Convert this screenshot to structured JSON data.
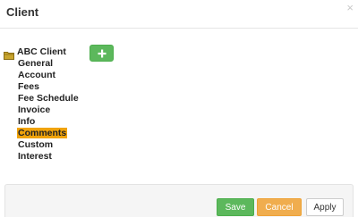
{
  "modal": {
    "title": "Client",
    "close_icon": "close-icon"
  },
  "tree": {
    "root": {
      "label": "ABC Client",
      "icon": "folder-icon"
    },
    "items": [
      {
        "label": "General"
      },
      {
        "label": "Account"
      },
      {
        "label": "Fees"
      },
      {
        "label": "Fee Schedule"
      },
      {
        "label": "Invoice"
      },
      {
        "label": "Info"
      },
      {
        "label": "Comments",
        "selected": true
      },
      {
        "label": "Custom"
      },
      {
        "label": "Interest"
      }
    ]
  },
  "toolbar": {
    "add_icon": "plus-icon"
  },
  "footer": {
    "save_label": "Save",
    "cancel_label": "Cancel",
    "apply_label": "Apply"
  },
  "colors": {
    "selected_highlight": "#f0a30a",
    "save": "#5cb85c",
    "cancel": "#f0ad4e",
    "folder": "#c8a52e"
  }
}
